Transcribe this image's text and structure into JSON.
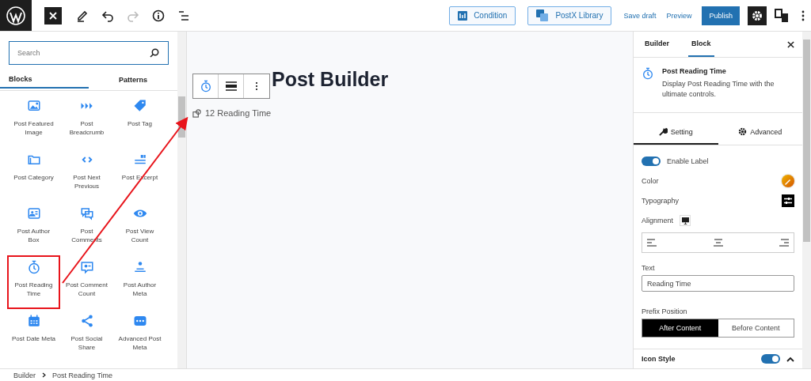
{
  "topbar": {
    "buttons": [
      {
        "label": "Condition",
        "kind": "condition"
      },
      {
        "label": "PostX Library",
        "kind": "library"
      }
    ],
    "save_draft": "Save draft",
    "preview": "Preview",
    "publish": "Publish"
  },
  "inserter": {
    "search": {
      "placeholder": "Search"
    },
    "tabs": [
      {
        "label": "Blocks",
        "selected": true
      },
      {
        "label": "Patterns",
        "selected": false
      }
    ],
    "blocks": [
      {
        "label": "Post Featured Image",
        "highlighted": false
      },
      {
        "label": "Post Breadcrumb",
        "highlighted": false
      },
      {
        "label": "Post Tag",
        "highlighted": false
      },
      {
        "label": "Post Category",
        "highlighted": false
      },
      {
        "label": "Post Next Previous",
        "highlighted": false
      },
      {
        "label": "Post Excerpt",
        "highlighted": false
      },
      {
        "label": "Post Author Box",
        "highlighted": false
      },
      {
        "label": "Post Comments",
        "highlighted": false
      },
      {
        "label": "Post View Count",
        "highlighted": false
      },
      {
        "label": "Post Reading Time",
        "highlighted": true
      },
      {
        "label": "Post Comment Count",
        "highlighted": false
      },
      {
        "label": "Post Author Meta",
        "highlighted": false
      },
      {
        "label": "Post Date Meta",
        "highlighted": false
      },
      {
        "label": "Post Social Share",
        "highlighted": false
      },
      {
        "label": "Advanced Post Meta",
        "highlighted": false
      }
    ]
  },
  "canvas": {
    "title": "Post Builder",
    "reading_time": "12 Reading Time"
  },
  "settings": {
    "tabs": [
      {
        "label": "Builder",
        "selected": false
      },
      {
        "label": "Block",
        "selected": true
      }
    ],
    "block_title": "Post Reading Time",
    "block_description": "Display Post Reading Time with the ultimate controls.",
    "subtabs": [
      {
        "label": "Setting",
        "selected": true,
        "kind": "wrench"
      },
      {
        "label": "Advanced",
        "selected": false,
        "kind": "gear"
      }
    ],
    "enable_label": {
      "label": "Enable Label",
      "on": true
    },
    "color_label": "Color",
    "typography_label": "Typography",
    "alignment_label": "Alignment",
    "text_field": {
      "label": "Text",
      "value": "Reading Time"
    },
    "prefix_position": {
      "label": "Prefix Position",
      "options": [
        {
          "label": "After Content",
          "selected": true
        },
        {
          "label": "Before Content",
          "selected": false
        }
      ]
    },
    "icon_style": {
      "label": "Icon Style",
      "on": true
    }
  },
  "breadcrumb": [
    "Builder",
    "Post Reading Time"
  ]
}
